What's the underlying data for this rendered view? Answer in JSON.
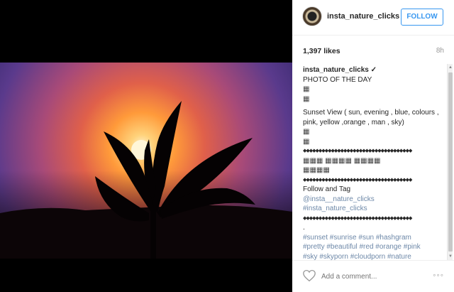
{
  "post": {
    "username": "insta_nature_clicks",
    "follow_label": "FOLLOW",
    "likes": "1,397 likes",
    "age": "8h"
  },
  "caption": {
    "username": "insta_nature_clicks ✓",
    "title": "PHOTO OF THE DAY",
    "box1": "▦",
    "box2": "▦",
    "description": "Sunset View ( sun, evening , blue, colours , pink, yellow ,orange , man , sky)",
    "box3": "▦",
    "box4": "▦",
    "diamonds1": "◆◆◆◆◆◆◆◆◆◆◆◆◆◆◆◆◆◆◆◆◆◆◆◆◆◆◆◆◆◆◆◆◆◆◆",
    "boxes_row1": "▦▦▦ ▦▦▦▦ ▦▦▦▦",
    "boxes_row2": "▦▦▦▦",
    "diamonds2": "◆◆◆◆◆◆◆◆◆◆◆◆◆◆◆◆◆◆◆◆◆◆◆◆◆◆◆◆◆◆◆◆◆◆◆",
    "follow_tag": "Follow and Tag",
    "mention": "@insta__nature_clicks",
    "tag_main": "#insta_nature_clicks",
    "diamonds3": "◆◆◆◆◆◆◆◆◆◆◆◆◆◆◆◆◆◆◆◆◆◆◆◆◆◆◆◆◆◆◆◆◆◆◆",
    "dot": ".",
    "hashtags1": "#sunset #sunrise #sun #hashgram",
    "hashtags2": "#pretty #beautiful #red #orange #pink",
    "hashtags3": "#sky #skyporn #cloudporn #nature"
  },
  "comment": {
    "placeholder": "Add a comment...",
    "more": "◦◦◦"
  },
  "icons": {
    "heart": "heart-icon",
    "more": "more-icon",
    "avatar": "avatar"
  }
}
